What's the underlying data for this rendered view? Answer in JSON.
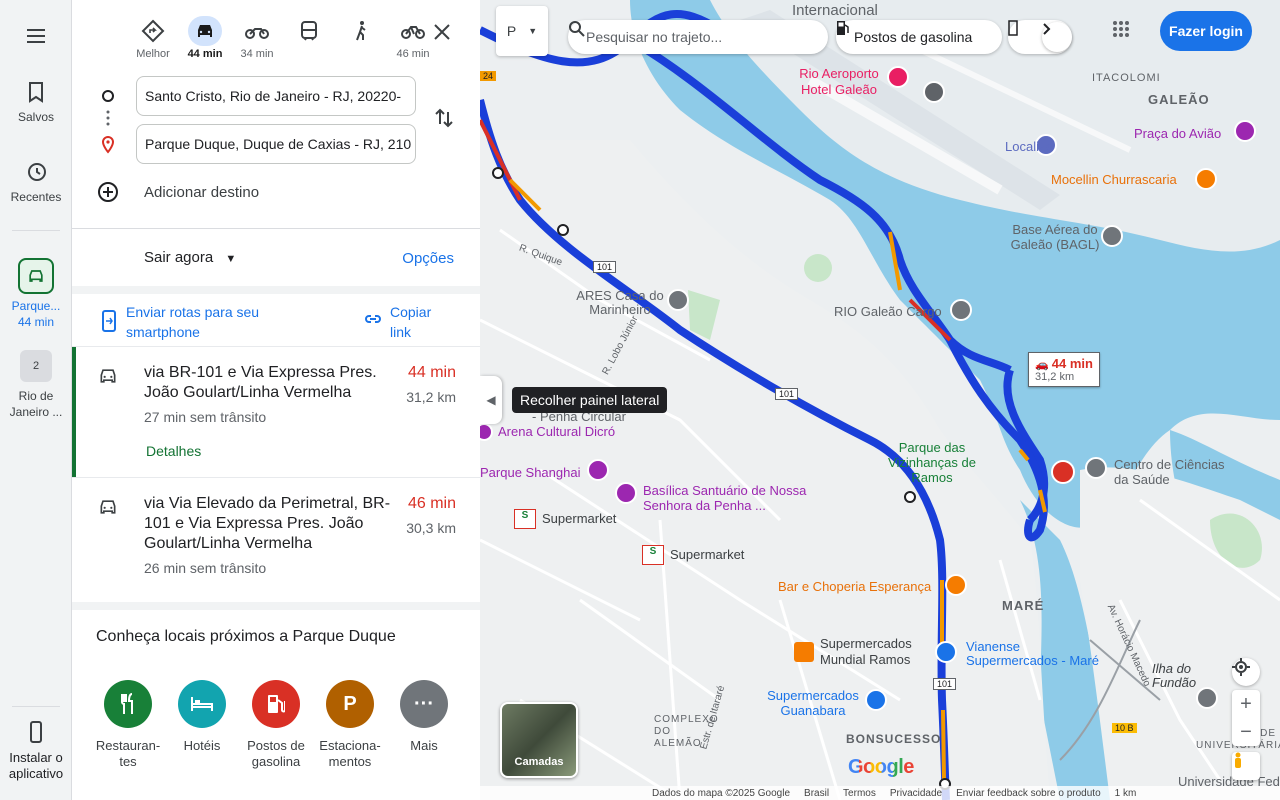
{
  "rail": {
    "menu_icon": "hamburger-icon",
    "saved": "Salvos",
    "recent": "Recentes",
    "recent_item1": "Parque... 44 min",
    "recent_item1_title": "Parque...",
    "recent_item1_time": "44 min",
    "recent_item2_title": "Rio de Janeiro ...",
    "install": "Instalar o aplicativo"
  },
  "modes": [
    {
      "label": "Melhor",
      "icon": "best-route-icon"
    },
    {
      "label": "44 min",
      "icon": "car-icon"
    },
    {
      "label": "34 min",
      "icon": "motorcycle-icon"
    },
    {
      "label": "",
      "icon": "transit-icon"
    },
    {
      "label": "",
      "icon": "walk-icon"
    },
    {
      "label": "46 min",
      "icon": "bike-icon"
    }
  ],
  "route": {
    "origin": "Santo Cristo, Rio de Janeiro - RJ, 20220-",
    "destination": "Parque Duque, Duque de Caxias - RJ, 210",
    "add_destination": "Adicionar destino"
  },
  "depart": {
    "label": "Sair agora",
    "options": "Opções"
  },
  "share": {
    "send": "Enviar rotas para seu smartphone",
    "copy": "Copiar link"
  },
  "routes": [
    {
      "title": "via BR-101 e Via Expressa Pres. João Goulart/Linha Vermelha",
      "time": "44 min",
      "distance": "31,2 km",
      "sub": "27 min sem trânsito",
      "details": "Detalhes"
    },
    {
      "title": "via Via Elevado da Perimetral, BR-101 e Via Expressa Pres. João Goulart/Linha Vermelha",
      "time": "46 min",
      "distance": "30,3 km",
      "sub": "26 min sem trânsito"
    }
  ],
  "nearby": {
    "title": "Conheça locais próximos a Parque Duque",
    "categories": [
      {
        "label": "Restauran-tes",
        "color": "#188038",
        "icon": "fork-knife-icon"
      },
      {
        "label": "Hotéis",
        "color": "#12a4af",
        "icon": "bed-icon"
      },
      {
        "label": "Postos de gasolina",
        "color": "#d93025",
        "icon": "fuel-icon"
      },
      {
        "label": "Estaciona-mentos",
        "color": "#b06000",
        "icon": "parking-icon"
      },
      {
        "label": "Mais",
        "color": "#70757a",
        "icon": "more-icon"
      }
    ]
  },
  "map": {
    "search_placeholder": "Pesquisar no trajeto...",
    "gas_chip": "Postos de gasolina",
    "login": "Fazer login",
    "tooltip": "Recolher painel lateral",
    "badge_time": "44 min",
    "badge_dist": "31,2 km",
    "layers": "Camadas",
    "labels": {
      "internacional": "Internacional",
      "aeroporto": "Rio Aeroporto Hotel Galeão",
      "itacolomi": "ITACOLOMI",
      "galeao": "GALEÃO",
      "praca": "Praça do Avião",
      "localiza": "Localiza",
      "mocellin": "Mocellin Churrascaria",
      "base": "Base Aérea do Galeão (BAGL)",
      "galeao_cargo": "RIO Galeão Cargo",
      "ares": "ARES Casa do Marinheiro",
      "quique": "R. Quique",
      "penha": "- Penha Circular",
      "arena": "Arena Cultural Dicró",
      "shanghai": "Parque Shanghai",
      "vizinhancas": "Parque das Vizinhanças de Ramos",
      "basilica": "Basílica Santuário de Nossa Senhora da Penha ...",
      "super1": "Supermarket",
      "super2": "Supermarket",
      "centro": "Centro de Ciências da Saúde",
      "bar": "Bar e Choperia Esperança",
      "mare": "MARÉ",
      "mundial": "Supermercados Mundial Ramos",
      "vianense": "Vianense Supermercados - Maré",
      "guanabara": "Supermercados Guanabara",
      "alemao": "COMPLEXO DO ALEMÃO",
      "bonsucesso": "BONSUCESSO",
      "fundao": "Ilha do Fundão",
      "cidade": "CIDADE UNIVERSITÁRIA",
      "universidade": "Universidade Fed",
      "lobo": "R. Lobo Júnior",
      "itarare": "Estr. de Itararé",
      "horacio": "Av. Horácio Macedo",
      "route101a": "101",
      "route101b": "101",
      "route101c": "101",
      "route24": "24",
      "route10b": "10 B"
    },
    "footer": [
      "Dados do mapa ©2025 Google",
      "Brasil",
      "Termos",
      "Privacidade",
      "Enviar feedback sobre o produto",
      "1 km"
    ],
    "google_logo": "Google"
  }
}
